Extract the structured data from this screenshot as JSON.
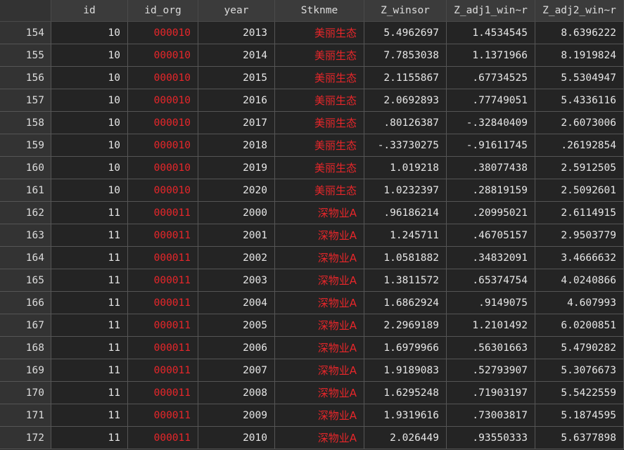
{
  "columns": [
    "id",
    "id_org",
    "year",
    "Stknme",
    "Z_winsor",
    "Z_adj1_win~r",
    "Z_adj2_win~r"
  ],
  "colors": {
    "background": "#242424",
    "header_bg": "#3b3b3b",
    "string_text": "#e8262a",
    "numeric_text": "#e6e6e6",
    "grid_line": "#555555"
  },
  "rows": [
    {
      "obs": "154",
      "id": "10",
      "id_org": "000010",
      "year": "2013",
      "Stknme": "美丽生态",
      "Z_winsor": "5.4962697",
      "Z_adj1_winsor": "1.4534545",
      "Z_adj2_winsor": "8.6396222"
    },
    {
      "obs": "155",
      "id": "10",
      "id_org": "000010",
      "year": "2014",
      "Stknme": "美丽生态",
      "Z_winsor": "7.7853038",
      "Z_adj1_winsor": "1.1371966",
      "Z_adj2_winsor": "8.1919824"
    },
    {
      "obs": "156",
      "id": "10",
      "id_org": "000010",
      "year": "2015",
      "Stknme": "美丽生态",
      "Z_winsor": "2.1155867",
      "Z_adj1_winsor": ".67734525",
      "Z_adj2_winsor": "5.5304947"
    },
    {
      "obs": "157",
      "id": "10",
      "id_org": "000010",
      "year": "2016",
      "Stknme": "美丽生态",
      "Z_winsor": "2.0692893",
      "Z_adj1_winsor": ".77749051",
      "Z_adj2_winsor": "5.4336116"
    },
    {
      "obs": "158",
      "id": "10",
      "id_org": "000010",
      "year": "2017",
      "Stknme": "美丽生态",
      "Z_winsor": ".80126387",
      "Z_adj1_winsor": "-.32840409",
      "Z_adj2_winsor": "2.6073006"
    },
    {
      "obs": "159",
      "id": "10",
      "id_org": "000010",
      "year": "2018",
      "Stknme": "美丽生态",
      "Z_winsor": "-.33730275",
      "Z_adj1_winsor": "-.91611745",
      "Z_adj2_winsor": ".26192854"
    },
    {
      "obs": "160",
      "id": "10",
      "id_org": "000010",
      "year": "2019",
      "Stknme": "美丽生态",
      "Z_winsor": "1.019218",
      "Z_adj1_winsor": ".38077438",
      "Z_adj2_winsor": "2.5912505"
    },
    {
      "obs": "161",
      "id": "10",
      "id_org": "000010",
      "year": "2020",
      "Stknme": "美丽生态",
      "Z_winsor": "1.0232397",
      "Z_adj1_winsor": ".28819159",
      "Z_adj2_winsor": "2.5092601"
    },
    {
      "obs": "162",
      "id": "11",
      "id_org": "000011",
      "year": "2000",
      "Stknme": "深物业A",
      "Z_winsor": ".96186214",
      "Z_adj1_winsor": ".20995021",
      "Z_adj2_winsor": "2.6114915"
    },
    {
      "obs": "163",
      "id": "11",
      "id_org": "000011",
      "year": "2001",
      "Stknme": "深物业A",
      "Z_winsor": "1.245711",
      "Z_adj1_winsor": ".46705157",
      "Z_adj2_winsor": "2.9503779"
    },
    {
      "obs": "164",
      "id": "11",
      "id_org": "000011",
      "year": "2002",
      "Stknme": "深物业A",
      "Z_winsor": "1.0581882",
      "Z_adj1_winsor": ".34832091",
      "Z_adj2_winsor": "3.4666632"
    },
    {
      "obs": "165",
      "id": "11",
      "id_org": "000011",
      "year": "2003",
      "Stknme": "深物业A",
      "Z_winsor": "1.3811572",
      "Z_adj1_winsor": ".65374754",
      "Z_adj2_winsor": "4.0240866"
    },
    {
      "obs": "166",
      "id": "11",
      "id_org": "000011",
      "year": "2004",
      "Stknme": "深物业A",
      "Z_winsor": "1.6862924",
      "Z_adj1_winsor": ".9149075",
      "Z_adj2_winsor": "4.607993"
    },
    {
      "obs": "167",
      "id": "11",
      "id_org": "000011",
      "year": "2005",
      "Stknme": "深物业A",
      "Z_winsor": "2.2969189",
      "Z_adj1_winsor": "1.2101492",
      "Z_adj2_winsor": "6.0200851"
    },
    {
      "obs": "168",
      "id": "11",
      "id_org": "000011",
      "year": "2006",
      "Stknme": "深物业A",
      "Z_winsor": "1.6979966",
      "Z_adj1_winsor": ".56301663",
      "Z_adj2_winsor": "5.4790282"
    },
    {
      "obs": "169",
      "id": "11",
      "id_org": "000011",
      "year": "2007",
      "Stknme": "深物业A",
      "Z_winsor": "1.9189083",
      "Z_adj1_winsor": ".52793907",
      "Z_adj2_winsor": "5.3076673"
    },
    {
      "obs": "170",
      "id": "11",
      "id_org": "000011",
      "year": "2008",
      "Stknme": "深物业A",
      "Z_winsor": "1.6295248",
      "Z_adj1_winsor": ".71903197",
      "Z_adj2_winsor": "5.5422559"
    },
    {
      "obs": "171",
      "id": "11",
      "id_org": "000011",
      "year": "2009",
      "Stknme": "深物业A",
      "Z_winsor": "1.9319616",
      "Z_adj1_winsor": ".73003817",
      "Z_adj2_winsor": "5.1874595"
    },
    {
      "obs": "172",
      "id": "11",
      "id_org": "000011",
      "year": "2010",
      "Stknme": "深物业A",
      "Z_winsor": "2.026449",
      "Z_adj1_winsor": ".93550333",
      "Z_adj2_winsor": "5.6377898"
    }
  ]
}
